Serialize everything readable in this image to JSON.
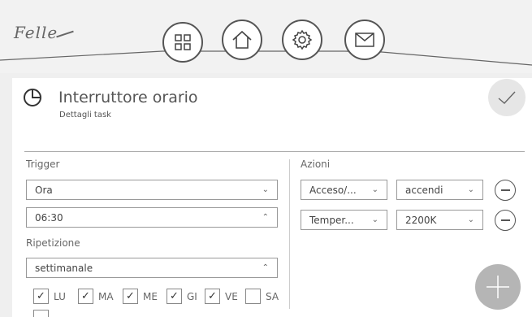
{
  "header": {
    "logo_text": "Felle"
  },
  "nav": [
    {
      "name": "grid"
    },
    {
      "name": "home"
    },
    {
      "name": "gear"
    },
    {
      "name": "mail"
    }
  ],
  "page": {
    "title": "Interruttore orario",
    "subtitle": "Dettagli task"
  },
  "trigger": {
    "label": "Trigger",
    "type_value": "Ora",
    "time_value": "06:30",
    "repeat_label": "Ripetizione",
    "repeat_value": "settimanale",
    "days": [
      {
        "label": "LU",
        "checked": true
      },
      {
        "label": "MA",
        "checked": true
      },
      {
        "label": "ME",
        "checked": true
      },
      {
        "label": "GI",
        "checked": true
      },
      {
        "label": "VE",
        "checked": true
      },
      {
        "label": "SA",
        "checked": false
      }
    ]
  },
  "actions": {
    "label": "Azioni",
    "rows": [
      {
        "function": "Acceso/...",
        "value": "accendi"
      },
      {
        "function": "Temper...",
        "value": "2200K"
      }
    ]
  },
  "colors": {
    "accent_grey": "#b5b5b5",
    "border": "#999999"
  }
}
